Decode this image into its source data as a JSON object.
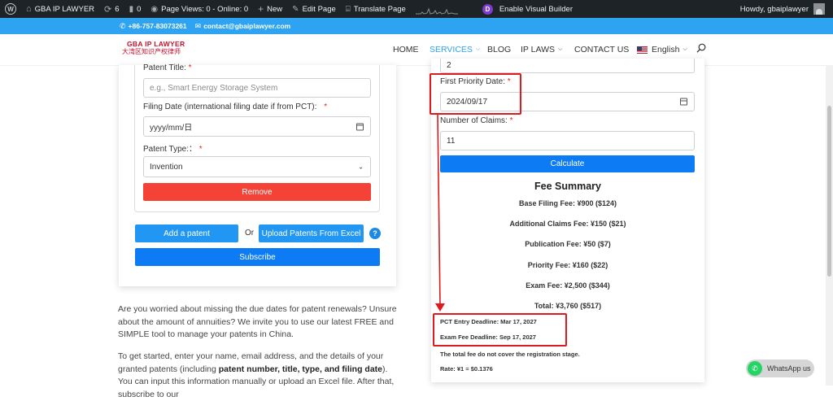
{
  "admin_bar": {
    "site_name": "GBA IP LAWYER",
    "updates_count": "6",
    "comments_count": "0",
    "page_views": "Page Views: 0 - Online: 0",
    "new_label": "New",
    "edit_page": "Edit Page",
    "translate_page": "Translate Page",
    "visual_builder": "Enable Visual Builder",
    "howdy": "Howdy, gbaiplawyer",
    "colors": {
      "background": "#1d2327",
      "text": "#f0f0f1",
      "divi": "#7e3bd0"
    }
  },
  "top_bar": {
    "phone": "+86-757-83073261",
    "email": "contact@gbaiplawyer.com",
    "color": "#2ea3f2"
  },
  "header": {
    "logo_line1": "GBA IP LAWYER",
    "logo_line2": "大湾区知识产权律师",
    "menu": {
      "home": "HOME",
      "services": "SERVICES",
      "blog": "BLOG",
      "ip_laws": "IP LAWS",
      "contact": "CONTACT US",
      "language": "English"
    }
  },
  "patent_form": {
    "title_label": "Patent Title:",
    "title_placeholder": "e.g., Smart Energy Storage System",
    "filing_label": "Filing Date (international filing date if from PCT):",
    "filing_value": "yyyy/mm/日",
    "type_label": "Patent Type:",
    "type_selected": "Invention",
    "remove_label": "Remove",
    "add_label": "Add a patent",
    "or_label": "Or",
    "upload_label": "Upload Patents From Excel",
    "help_label": "?",
    "subscribe_label": "Subscribe",
    "required_mark": "*",
    "colon": "："
  },
  "paragraphs": {
    "p1": "Are you worried about missing the due dates for patent renewals? Unsure about the amount of annuities? We invite you to use our latest FREE and SIMPLE tool to manage your patents in China.",
    "p2_a": "To get started, enter your name, email address, and the details of your granted patents (including ",
    "p2_b": "patent number, title, type, and filing date",
    "p2_c": "). You can input this information manually or upload an Excel file. After that, subscribe to our"
  },
  "calculator": {
    "prev_value": "2",
    "priority_label": "First Priority Date:",
    "priority_value": "2024/09/17",
    "claims_label": "Number of Claims:",
    "claims_value": "11",
    "calculate_label": "Calculate",
    "summary_title": "Fee Summary",
    "fees": [
      "Base Filing Fee: ¥900 ($124)",
      "Additional Claims Fee: ¥150 ($21)",
      "Publication Fee: ¥50 ($7)",
      "Priority Fee: ¥160 ($22)",
      "Exam Fee: ¥2,500 ($344)",
      "Total: ¥3,760 ($517)"
    ],
    "pct_deadline": "PCT Entry Deadline: Mar 17, 2027",
    "exam_deadline": "Exam Fee Deadline: Sep 17, 2027",
    "note": "The total fee do not cover the registration stage.",
    "rate": "Rate: ¥1 = $0.1376"
  },
  "whatsapp": {
    "label": "WhatsApp us",
    "color": "#25d366"
  },
  "annotation_color": "#e0191e"
}
